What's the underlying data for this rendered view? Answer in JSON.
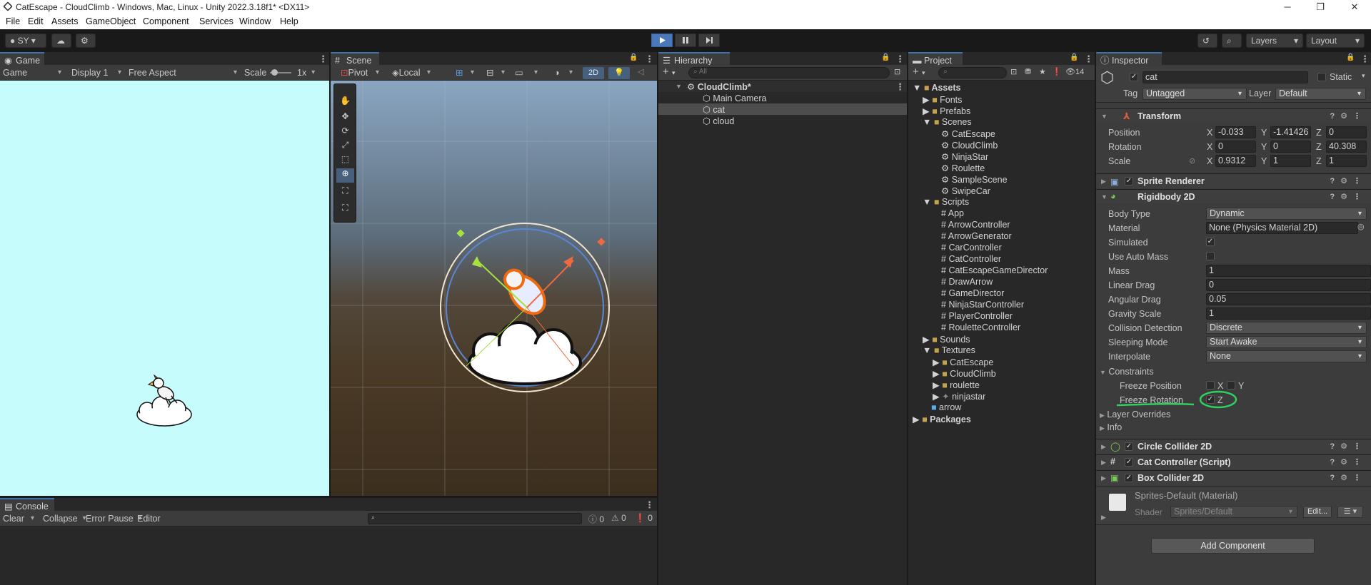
{
  "window": {
    "title": "CatEscape - CloudClimb - Windows, Mac, Linux - Unity 2022.3.18f1* <DX11>"
  },
  "menu": [
    "File",
    "Edit",
    "Assets",
    "GameObject",
    "Component",
    "Services",
    "Window",
    "Help"
  ],
  "toolbar": {
    "account": "SY",
    "layers": "Layers",
    "layout": "Layout"
  },
  "game": {
    "tab": "Game",
    "mode": "Game",
    "display": "Display 1",
    "aspect": "Free Aspect",
    "scale_label": "Scale",
    "scale_value": "1x",
    "background": "#c7fcfd"
  },
  "scene": {
    "tab": "Scene",
    "pivot": "Pivot",
    "local": "Local",
    "mode_2d": "2D"
  },
  "hierarchy": {
    "tab": "Hierarchy",
    "search_placeholder": "All",
    "root": "CloudClimb*",
    "items": [
      "Main Camera",
      "cat",
      "cloud"
    ],
    "selected": "cat"
  },
  "project": {
    "tab": "Project",
    "badge": "14",
    "assets": "Assets",
    "folders_top": [
      "Fonts",
      "Prefabs"
    ],
    "scenes_folder": "Scenes",
    "scenes": [
      "CatEscape",
      "CloudClimb",
      "NinjaStar",
      "Roulette",
      "SampleScene",
      "SwipeCar"
    ],
    "scripts_folder": "Scripts",
    "scripts": [
      "App",
      "ArrowController",
      "ArrowGenerator",
      "CarController",
      "CatController",
      "CatEscapeGameDirector",
      "DrawArrow",
      "GameDirector",
      "NinjaStarController",
      "PlayerController",
      "RouletteController"
    ],
    "sounds": "Sounds",
    "textures_folder": "Textures",
    "textures": [
      "CatEscape",
      "CloudClimb",
      "roulette"
    ],
    "ninjastar": "ninjastar",
    "arrow": "arrow",
    "packages": "Packages"
  },
  "console": {
    "tab": "Console",
    "clear": "Clear",
    "collapse": "Collapse",
    "error_pause": "Error Pause",
    "editor": "Editor",
    "counts": [
      "0",
      "0",
      "0"
    ]
  },
  "inspector": {
    "tab": "Inspector",
    "object_name": "cat",
    "static": "Static",
    "tag_label": "Tag",
    "tag": "Untagged",
    "layer_label": "Layer",
    "layer": "Default",
    "transform": {
      "title": "Transform",
      "position_label": "Position",
      "rotation_label": "Rotation",
      "scale_label": "Scale",
      "position": {
        "x": "-0.033",
        "y": "-1.41426",
        "z": "0"
      },
      "rotation": {
        "x": "0",
        "y": "0",
        "z": "40.308"
      },
      "scale": {
        "x": "0.9312",
        "y": "1",
        "z": "1"
      }
    },
    "sprite_renderer": "Sprite Renderer",
    "rigidbody": {
      "title": "Rigidbody 2D",
      "rows": [
        {
          "label": "Body Type",
          "value": "Dynamic",
          "kind": "dropdown"
        },
        {
          "label": "Material",
          "value": "None (Physics Material 2D)",
          "kind": "object"
        },
        {
          "label": "Simulated",
          "value": "✓",
          "kind": "check"
        },
        {
          "label": "Use Auto Mass",
          "value": "",
          "kind": "check"
        },
        {
          "label": "Mass",
          "value": "1",
          "kind": "field"
        },
        {
          "label": "Linear Drag",
          "value": "0",
          "kind": "field"
        },
        {
          "label": "Angular Drag",
          "value": "0.05",
          "kind": "field"
        },
        {
          "label": "Gravity Scale",
          "value": "1",
          "kind": "field"
        },
        {
          "label": "Collision Detection",
          "value": "Discrete",
          "kind": "dropdown"
        },
        {
          "label": "Sleeping Mode",
          "value": "Start Awake",
          "kind": "dropdown"
        },
        {
          "label": "Interpolate",
          "value": "None",
          "kind": "dropdown"
        }
      ],
      "constraints": "Constraints",
      "freeze_position": "Freeze Position",
      "freeze_rotation": "Freeze Rotation",
      "x": "X",
      "y": "Y",
      "z": "Z",
      "layer_overrides": "Layer Overrides",
      "info": "Info"
    },
    "components": [
      "Circle Collider 2D",
      "Cat Controller (Script)",
      "Box Collider 2D"
    ],
    "material": {
      "name": "Sprites-Default (Material)",
      "shader_label": "Shader",
      "shader": "Sprites/Default",
      "edit": "Edit..."
    },
    "add_component": "Add Component"
  }
}
